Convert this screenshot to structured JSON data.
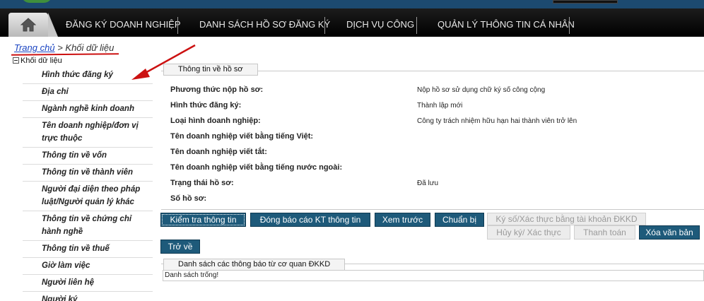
{
  "nav": {
    "items": [
      "ĐĂNG KÝ DOANH NGHIỆP",
      "DANH SÁCH HỒ SƠ ĐĂNG KÝ",
      "DỊCH VỤ CÔNG",
      "QUẢN LÝ THÔNG TIN CÁ NHÂN"
    ]
  },
  "breadcrumb": {
    "home": "Trang chủ",
    "separator": " > ",
    "current": "Khối dữ liệu"
  },
  "tree": {
    "root": "Khối dữ liệu",
    "items": [
      "Hình thức đăng ký",
      "Địa chỉ",
      "Ngành nghề kinh doanh",
      "Tên doanh nghiệp/đơn vị trực thuộc",
      "Thông tin về vốn",
      "Thông tin về thành viên",
      "Người đại diện theo pháp luật/Người quản lý khác",
      "Thông tin về chứng chỉ hành nghề",
      "Thông tin về thuế",
      "Giờ làm việc",
      "Người liên hệ",
      "Người ký"
    ]
  },
  "profile": {
    "legend": "Thông tin về hồ sơ",
    "fields": [
      {
        "label": "Phương thức nộp hồ sơ:",
        "value": "Nộp hồ sơ sử dụng chữ ký số công cộng"
      },
      {
        "label": "Hình thức đăng ký:",
        "value": "Thành lập mới"
      },
      {
        "label": "Loại hình doanh nghiệp:",
        "value": "Công ty trách nhiệm hữu hạn hai thành viên trở lên"
      },
      {
        "label": "Tên doanh nghiệp viết bằng tiếng Việt:",
        "value": ""
      },
      {
        "label": "Tên doanh nghiệp viết tắt:",
        "value": ""
      },
      {
        "label": "Tên doanh nghiệp viết bằng tiếng nước ngoài:",
        "value": ""
      },
      {
        "label": "Trạng thái hồ sơ:",
        "value": "Đã lưu"
      },
      {
        "label": "Số hồ sơ:",
        "value": ""
      }
    ]
  },
  "buttons": {
    "check": "Kiểm tra thông tin",
    "report": "Đóng báo cáo KT thông tin",
    "preview": "Xem trước",
    "prepare": "Chuẩn bị",
    "sign_account": "Ký số/Xác thực bằng tài khoản ĐKKD",
    "cancel_sign": "Hủy ký/ Xác thực",
    "pay": "Thanh toán",
    "delete_doc": "Xóa văn bản",
    "back": "Trở về"
  },
  "notices": {
    "legend": "Danh sách các thông báo từ cơ quan ĐKKD",
    "empty_text": "Danh sách trống!"
  },
  "colors": {
    "nav_bg": "#000000",
    "button_bg": "#1e5a7a",
    "annotation_red": "#cc1111",
    "breadcrumb_link": "#1a44c2"
  }
}
